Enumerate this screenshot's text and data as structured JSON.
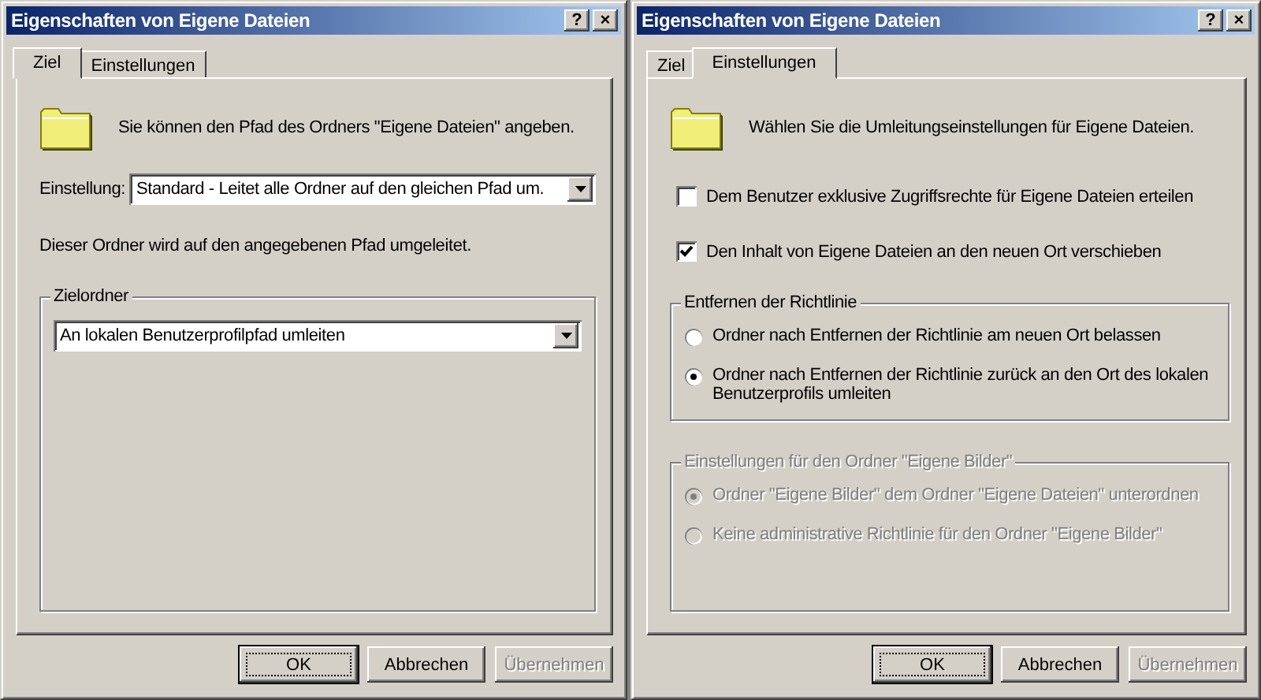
{
  "dialogs": [
    {
      "title": "Eigenschaften von Eigene Dateien",
      "title_buttons": [
        "?",
        "×"
      ],
      "tabs": [
        {
          "label": "Ziel",
          "selected": true
        },
        {
          "label": "Einstellungen",
          "selected": false
        }
      ],
      "content": [
        {
          "kind": "intro",
          "text": "Sie können den Pfad des Ordners \"Eigene Dateien\" angeben."
        },
        {
          "kind": "dropdown",
          "label": "Einstellung:",
          "value": "Standard - Leitet alle Ordner auf den gleichen Pfad um."
        },
        {
          "kind": "note",
          "text": "Dieser Ordner wird auf den angegebenen Pfad umgeleitet."
        },
        {
          "kind": "group",
          "title": "Zielordner",
          "disabled": false,
          "items": [
            {
              "kind": "dropdown",
              "value": "An lokalen Benutzerprofilpfad umleiten"
            }
          ]
        }
      ],
      "buttons": [
        {
          "label": "OK",
          "default": true,
          "disabled": false
        },
        {
          "label": "Abbrechen",
          "default": false,
          "disabled": false
        },
        {
          "label": "Übernehmen",
          "default": false,
          "disabled": true
        }
      ]
    },
    {
      "title": "Eigenschaften von Eigene Dateien",
      "title_buttons": [
        "?",
        "×"
      ],
      "tabs": [
        {
          "label": "Ziel",
          "selected": false
        },
        {
          "label": "Einstellungen",
          "selected": true
        }
      ],
      "content": [
        {
          "kind": "intro",
          "text": "Wählen Sie die Umleitungseinstellungen für Eigene Dateien."
        },
        {
          "kind": "checkbox",
          "label": "Dem Benutzer exklusive Zugriffsrechte für Eigene Dateien erteilen",
          "checked": false
        },
        {
          "kind": "checkbox",
          "label": "Den Inhalt von Eigene Dateien an den neuen Ort verschieben",
          "checked": true
        },
        {
          "kind": "group",
          "title": "Entfernen der Richtlinie",
          "disabled": false,
          "items": [
            {
              "kind": "radio",
              "label": "Ordner nach Entfernen der Richtlinie am neuen Ort belassen",
              "selected": false
            },
            {
              "kind": "radio",
              "label": "Ordner nach Entfernen der Richtlinie zurück an den Ort des lokalen Benutzerprofils umleiten",
              "selected": true
            }
          ]
        },
        {
          "kind": "group",
          "title": "Einstellungen für den Ordner \"Eigene Bilder\"",
          "disabled": true,
          "items": [
            {
              "kind": "radio",
              "label": "Ordner \"Eigene Bilder\" dem Ordner \"Eigene Dateien\" unterordnen",
              "selected": true
            },
            {
              "kind": "radio",
              "label": "Keine administrative Richtlinie für den Ordner \"Eigene Bilder\"",
              "selected": false
            }
          ]
        }
      ],
      "buttons": [
        {
          "label": "OK",
          "default": true,
          "disabled": false
        },
        {
          "label": "Abbrechen",
          "default": false,
          "disabled": false
        },
        {
          "label": "Übernehmen",
          "default": false,
          "disabled": true
        }
      ]
    }
  ]
}
